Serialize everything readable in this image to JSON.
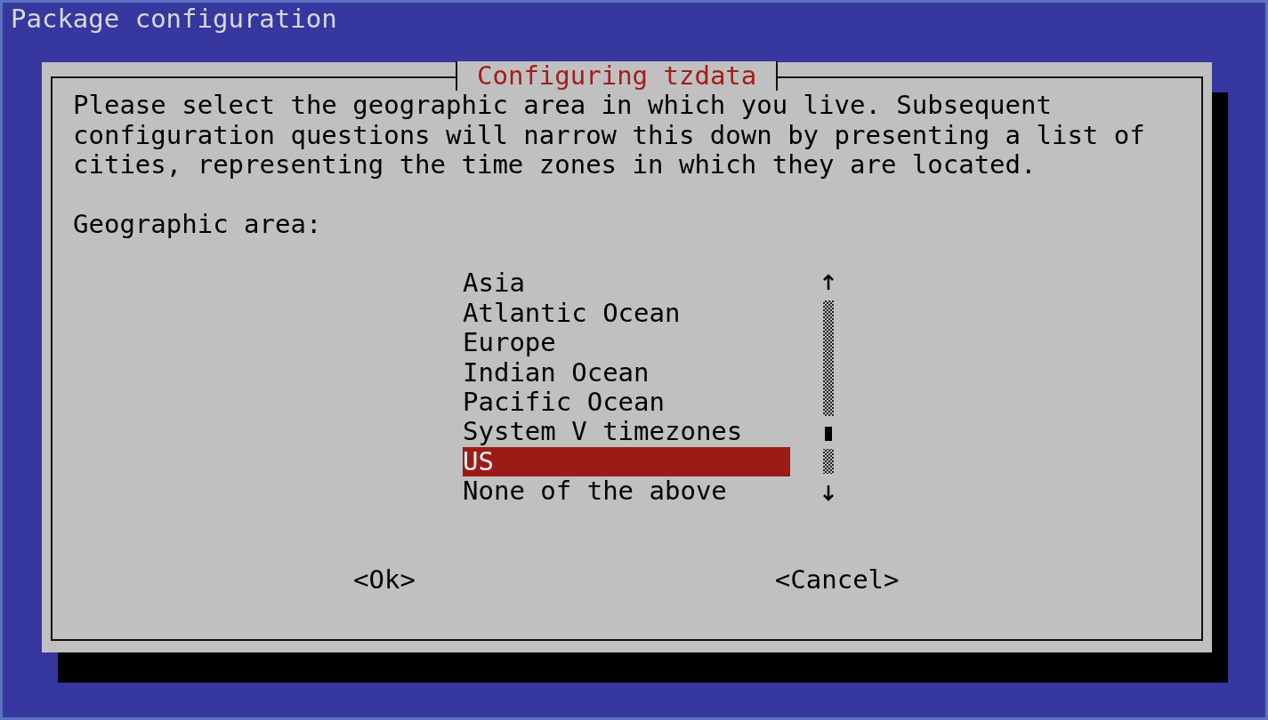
{
  "screen": {
    "title": "Package configuration"
  },
  "dialog": {
    "title": "Configuring tzdata",
    "message": "Please select the geographic area in which you live. Subsequent configuration questions will narrow this down by presenting a list of cities, representing the time zones in which they are located.",
    "prompt": "Geographic area:",
    "list": {
      "items": [
        {
          "label": "Asia",
          "selected": false
        },
        {
          "label": "Atlantic Ocean",
          "selected": false
        },
        {
          "label": "Europe",
          "selected": false
        },
        {
          "label": "Indian Ocean",
          "selected": false
        },
        {
          "label": "Pacific Ocean",
          "selected": false
        },
        {
          "label": "System V timezones",
          "selected": false
        },
        {
          "label": "US",
          "selected": true
        },
        {
          "label": "None of the above",
          "selected": false
        }
      ]
    },
    "buttons": [
      {
        "label": "<Ok>"
      },
      {
        "label": "<Cancel>"
      }
    ]
  }
}
